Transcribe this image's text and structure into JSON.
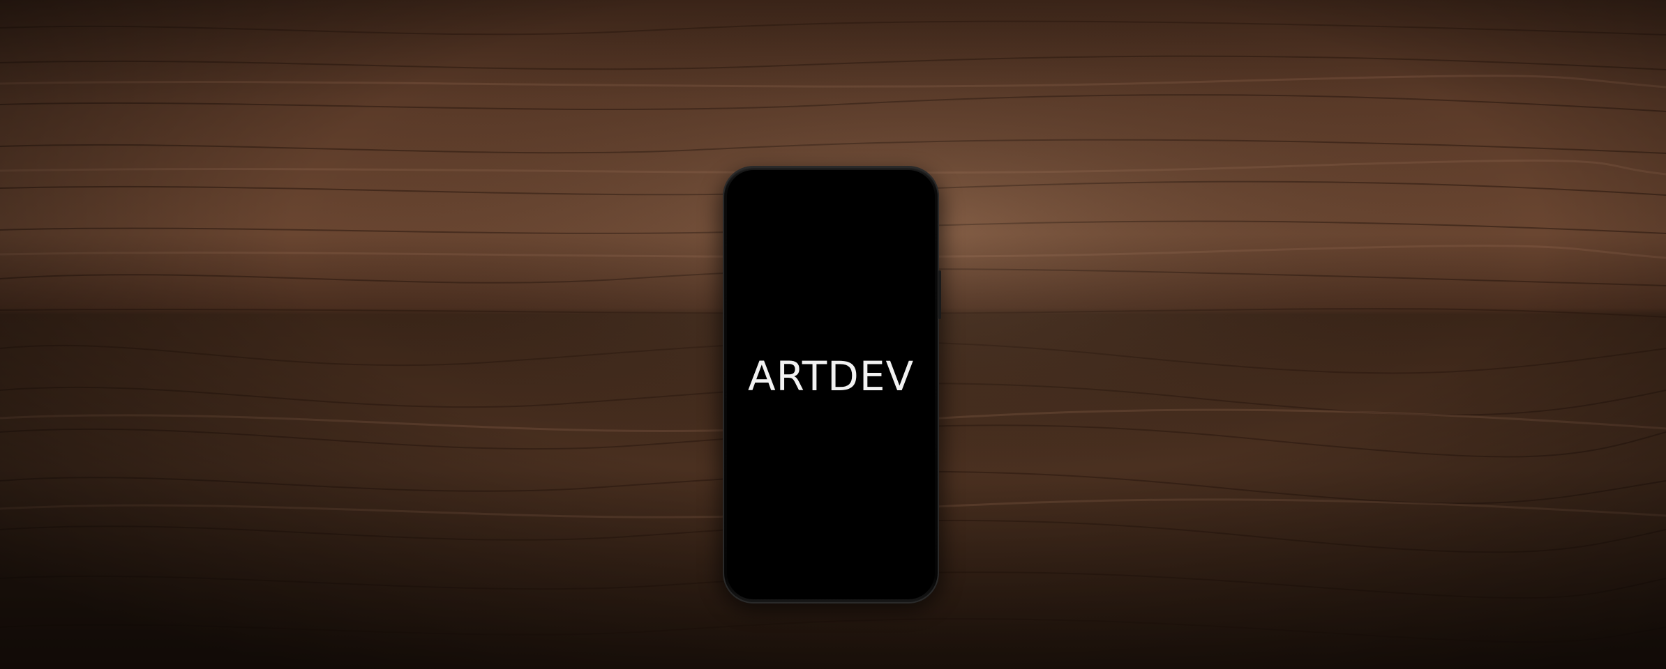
{
  "phone": {
    "screen_text": "ARTDEV"
  },
  "colors": {
    "wood_dark": "#2a1a12",
    "wood_mid": "#5a3a28",
    "wood_light": "#8a6248",
    "screen": "#000000",
    "text": "#f2f2f2"
  }
}
